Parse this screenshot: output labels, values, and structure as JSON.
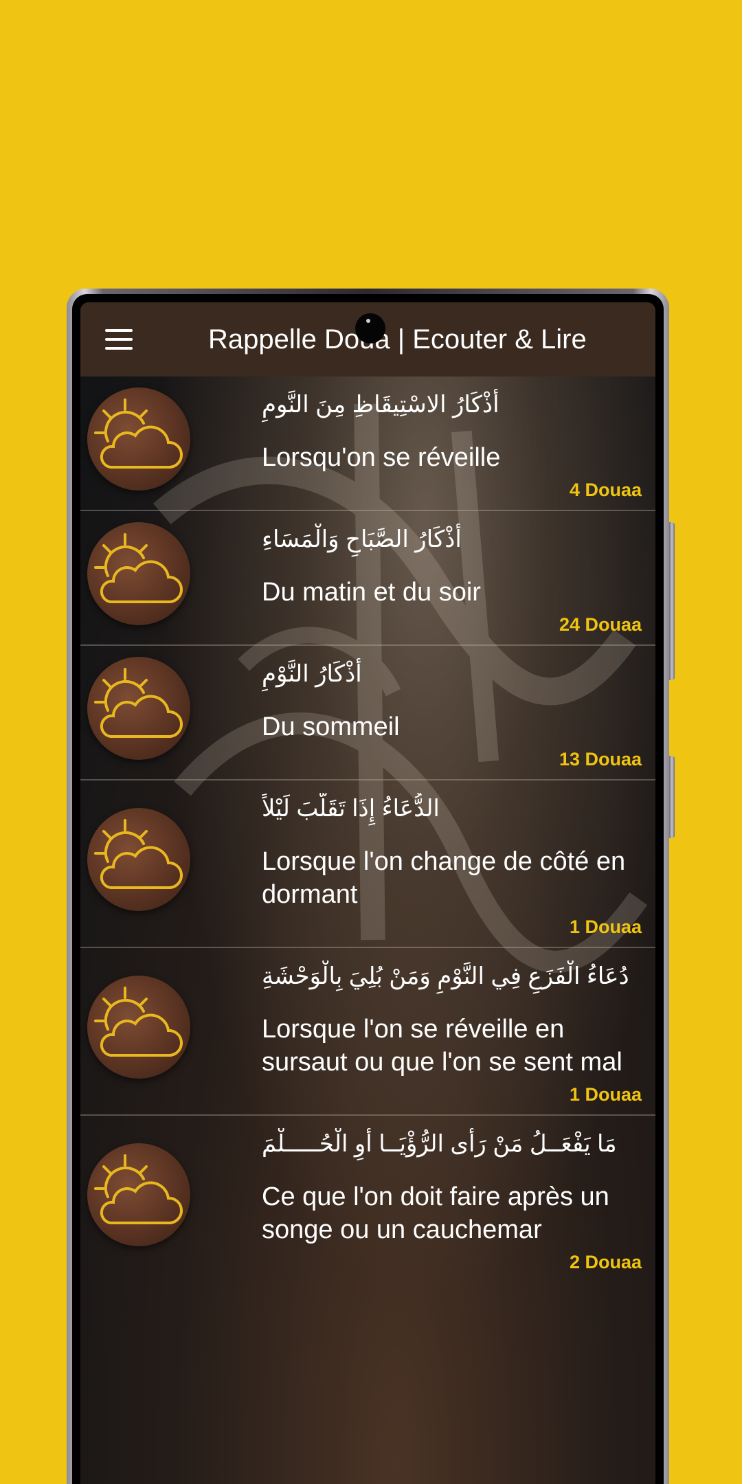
{
  "app": {
    "title": "Rappelle Doua | Ecouter & Lire"
  },
  "colors": {
    "background": "#f0c412",
    "accent": "#f0c412",
    "appbar": "#3a2a20"
  },
  "icons": {
    "menu": "hamburger-menu-icon",
    "item": "sun-cloud-icon"
  },
  "items": [
    {
      "arabic": "أَذْكَارُ الاسْتِيقَاظِ مِنَ النَّومِ",
      "french": "Lorsqu'on se réveille",
      "count": "4 Douaa"
    },
    {
      "arabic": "أَذْكَارُ الصَّبَاحِ وَالْمَسَاءِ",
      "french": "Du matin et du soir",
      "count": "24 Douaa"
    },
    {
      "arabic": "أَذْكَارُ النَّوْمِ",
      "french": "Du sommeil",
      "count": "13 Douaa"
    },
    {
      "arabic": "الدُّعَاءُ إِذَا تَقَلَّبَ لَيْلاً",
      "french": "Lorsque l'on change de côté en dormant",
      "count": "1 Douaa"
    },
    {
      "arabic": "دُعَاءُ الْفَزَعِ فِي النَّوْمِ وَمَنْ بُلِيَ بِالْوَحْشَةِ",
      "french": "Lorsque l'on se réveille en sursaut ou que l'on se sent mal",
      "count": "1 Douaa"
    },
    {
      "arabic": "مَا يَفْعَــلُ مَنْ رَأى الرُّؤْيَــا أوِ الْحُـــــلْمَ",
      "french": "Ce que l'on doit faire après un songe ou un cauchemar",
      "count": "2 Douaa"
    }
  ]
}
